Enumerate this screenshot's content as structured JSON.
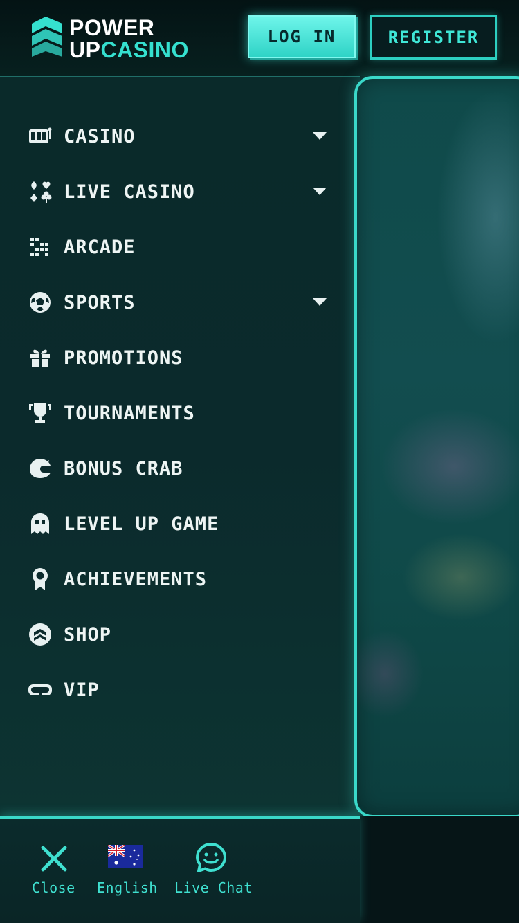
{
  "header": {
    "logo_line1": "POWER",
    "logo_line2_a": "UP",
    "logo_line2_b": "CASINO",
    "login_label": "LOG IN",
    "register_label": "REGISTER"
  },
  "menu": {
    "items": [
      {
        "label": "CASINO",
        "icon": "slot-machine-icon",
        "has_submenu": true
      },
      {
        "label": "LIVE CASINO",
        "icon": "card-suits-icon",
        "has_submenu": true
      },
      {
        "label": "ARCADE",
        "icon": "pixel-blocks-icon",
        "has_submenu": false
      },
      {
        "label": "SPORTS",
        "icon": "soccer-ball-icon",
        "has_submenu": true
      },
      {
        "label": "PROMOTIONS",
        "icon": "gift-icon",
        "has_submenu": false
      },
      {
        "label": "TOURNAMENTS",
        "icon": "trophy-icon",
        "has_submenu": false
      },
      {
        "label": "BONUS CRAB",
        "icon": "crab-claw-icon",
        "has_submenu": false
      },
      {
        "label": "LEVEL UP GAME",
        "icon": "ghost-icon",
        "has_submenu": false
      },
      {
        "label": "ACHIEVEMENTS",
        "icon": "medal-icon",
        "has_submenu": false
      },
      {
        "label": "SHOP",
        "icon": "shop-badge-icon",
        "has_submenu": false
      },
      {
        "label": "VIP",
        "icon": "vr-goggles-icon",
        "has_submenu": false
      }
    ]
  },
  "bottom": {
    "close_label": "Close",
    "language_label": "English",
    "live_chat_label": "Live Chat"
  },
  "colors": {
    "accent": "#3ad8c9",
    "background": "#06191b",
    "login_fill": "#4fe8dc",
    "text": "#eef5f4"
  }
}
